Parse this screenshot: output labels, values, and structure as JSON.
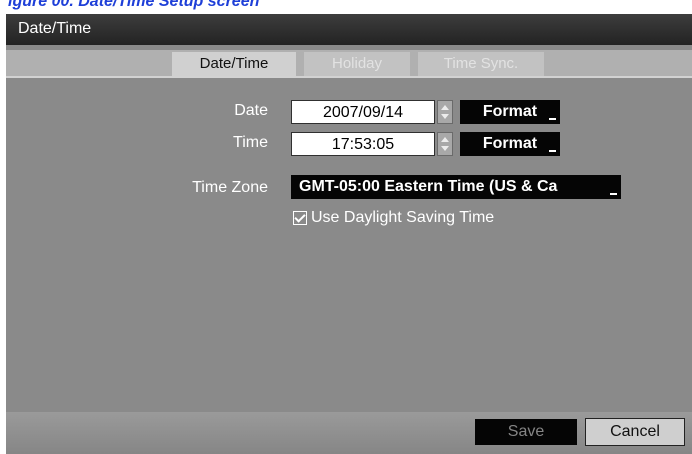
{
  "caption": "igure 00. Date/Time Setup screen",
  "window": {
    "title": "Date/Time"
  },
  "tabs": [
    {
      "label": "Date/Time",
      "active": true
    },
    {
      "label": "Holiday",
      "active": false
    },
    {
      "label": "Time Sync.",
      "active": false
    }
  ],
  "date": {
    "label": "Date",
    "value": "2007/09/14",
    "format_label": "Format"
  },
  "time": {
    "label": "Time",
    "value": "17:53:05",
    "format_label": "Format"
  },
  "timezone": {
    "label": "Time Zone",
    "value": "GMT-05:00  Eastern Time (US & Ca"
  },
  "dst": {
    "label": "Use Daylight Saving Time",
    "checked": true
  },
  "buttons": {
    "save": "Save",
    "cancel": "Cancel"
  },
  "colors": {
    "caption": "#1e3fd8",
    "background": "#8a8a8a",
    "title_bar": "#2f2f2f",
    "button_dark": "#050505"
  },
  "icons": {
    "stepper": "up-down-arrows",
    "checkbox": "check-icon"
  }
}
